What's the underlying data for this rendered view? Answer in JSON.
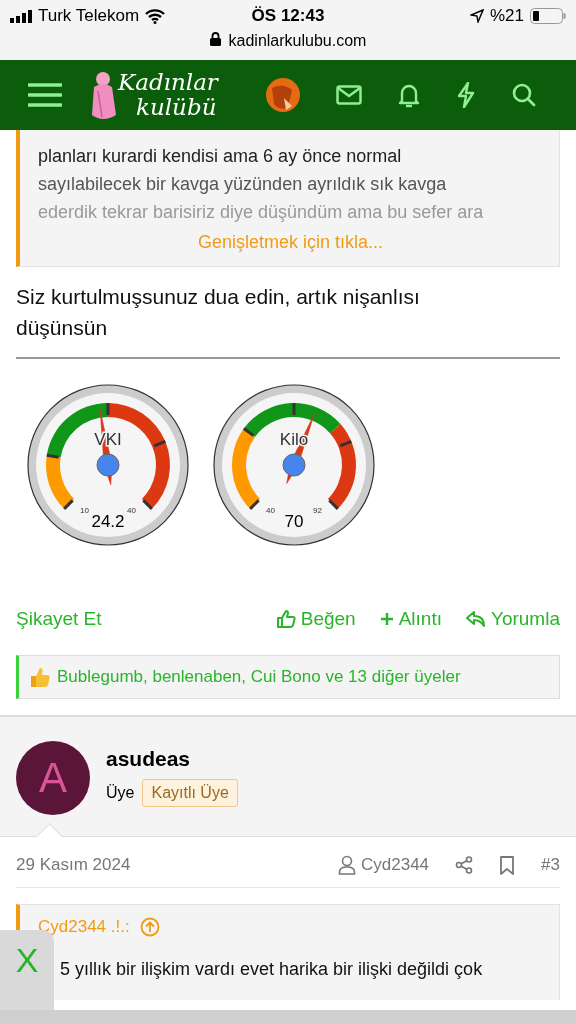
{
  "status_bar": {
    "carrier": "Turk Telekom",
    "time": "ÖS 12:43",
    "battery": "%21"
  },
  "url_bar": {
    "address": "kadinlarkulubu.com"
  },
  "header": {
    "logo": [
      "Kadınlar",
      "kulübü"
    ]
  },
  "post": {
    "quote": {
      "lines": [
        "planları kurardi kendisi ama 6 ay önce normal",
        "sayılabilecek bir kavga yüzünden ayrıldık sık kavga",
        "ederdik tekrar barisiriz diye düşündüm ama bu sefer ara"
      ],
      "expand_link": "Genişletmek için tıkla..."
    },
    "text": "Siz kurtulmuşsunuz dua edin, artık nişanlısı düşünsün",
    "gauges": [
      {
        "label": "VKI",
        "min": "10",
        "max": "40",
        "value": "24.2"
      },
      {
        "label": "Kilo",
        "min": "40",
        "max": "92",
        "value": "70"
      }
    ],
    "report": "Şikayet Et",
    "actions": [
      {
        "kind": "like",
        "label": "Beğen"
      },
      {
        "kind": "quote",
        "label": "Alıntı"
      },
      {
        "kind": "reply",
        "label": "Yorumla"
      }
    ],
    "reactions": "Bublegumb, benlenaben, Cui Bono ve 13 diğer üyeler"
  },
  "next_post": {
    "user": {
      "initial": "A",
      "name": "asudeas",
      "role": "Üye",
      "badge": "Kayıtlı Üye"
    },
    "date": "29 Kasım 2024",
    "author": "Cyd2344",
    "number": "#3",
    "quote": {
      "author": "Cyd2344 .!.:",
      "line": "5 yıllık bir ilişkim vardı evet harika bir ilişki değildi çok"
    }
  },
  "overlay": {
    "close": "X"
  }
}
